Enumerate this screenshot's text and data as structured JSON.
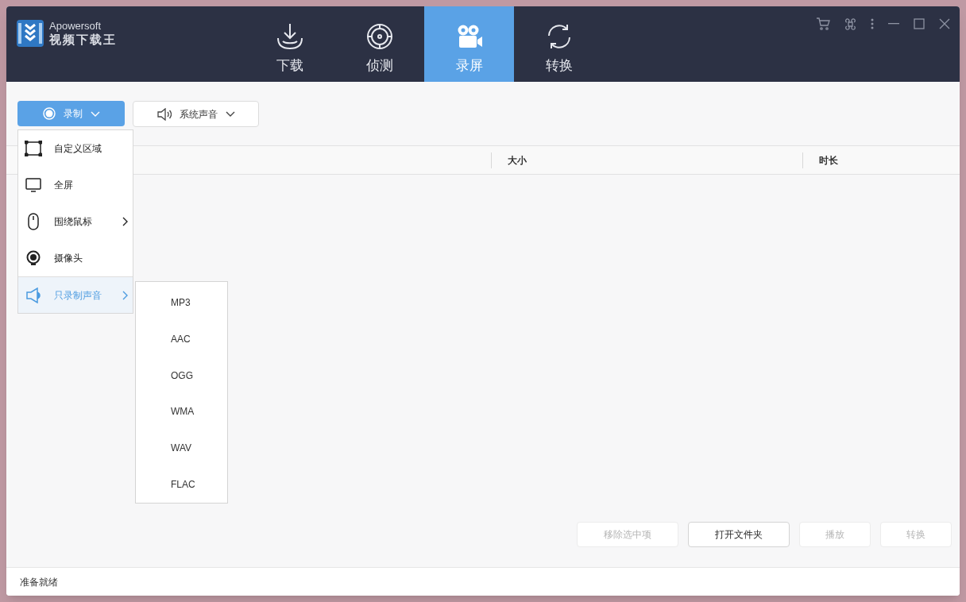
{
  "app": {
    "vendor": "Apowersoft",
    "title": "视频下载王"
  },
  "tabs": [
    {
      "kind": "download",
      "label": "下载",
      "selected": false
    },
    {
      "kind": "detect",
      "label": "侦测",
      "selected": false
    },
    {
      "kind": "record",
      "label": "录屏",
      "selected": true
    },
    {
      "kind": "convert",
      "label": "转换",
      "selected": false
    }
  ],
  "toolbar": {
    "record_button": "录制",
    "audio_source": "系统声音"
  },
  "table": {
    "columns": [
      {
        "label": "大小"
      },
      {
        "label": "时长"
      }
    ]
  },
  "record_menu": {
    "items": [
      {
        "kind": "region",
        "label": "自定义区域",
        "submenu": false,
        "selected": false
      },
      {
        "kind": "fullscreen",
        "label": "全屏",
        "submenu": false,
        "selected": false
      },
      {
        "kind": "mouse",
        "label": "围绕鼠标",
        "submenu": true,
        "selected": false
      },
      {
        "kind": "webcam",
        "label": "摄像头",
        "submenu": false,
        "selected": false
      },
      {
        "kind": "audio",
        "label": "只录制声音",
        "submenu": true,
        "selected": true
      }
    ]
  },
  "format_menu": {
    "items": [
      "MP3",
      "AAC",
      "OGG",
      "WMA",
      "WAV",
      "FLAC"
    ]
  },
  "actions": [
    {
      "label": "移除选中项",
      "disabled": true
    },
    {
      "label": "打开文件夹",
      "disabled": false
    },
    {
      "label": "播放",
      "disabled": true
    },
    {
      "label": "转换",
      "disabled": true
    }
  ],
  "status_bar": "准备就绪"
}
